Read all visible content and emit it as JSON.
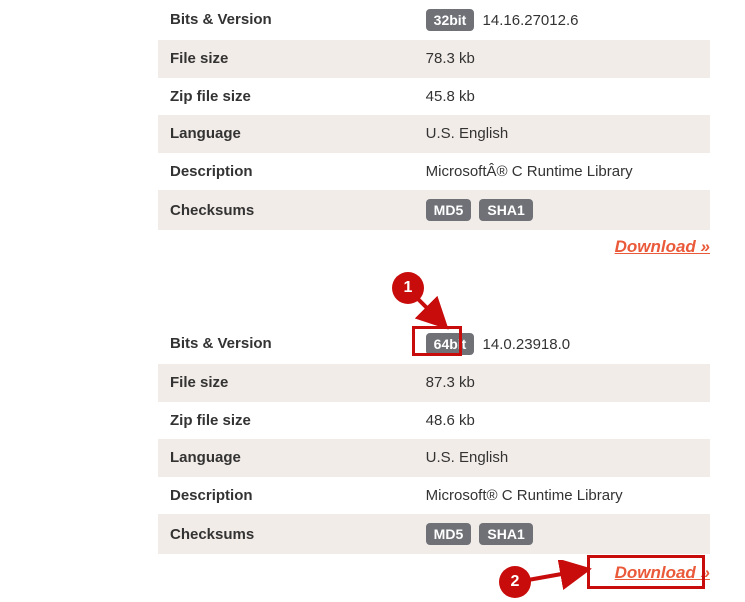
{
  "tables": [
    {
      "rows": [
        {
          "label": "Bits & Version",
          "badge": "32bit",
          "text": "14.16.27012.6"
        },
        {
          "label": "File size",
          "text": "78.3 kb"
        },
        {
          "label": "Zip file size",
          "text": "45.8 kb"
        },
        {
          "label": "Language",
          "text": "U.S. English"
        },
        {
          "label": "Description",
          "text": "MicrosoftÂ® C Runtime Library"
        },
        {
          "label": "Checksums",
          "badges": [
            "MD5",
            "SHA1"
          ]
        }
      ],
      "download": "Download »"
    },
    {
      "rows": [
        {
          "label": "Bits & Version",
          "badge": "64bit",
          "text": "14.0.23918.0"
        },
        {
          "label": "File size",
          "text": "87.3 kb"
        },
        {
          "label": "Zip file size",
          "text": "48.6 kb"
        },
        {
          "label": "Language",
          "text": "U.S. English"
        },
        {
          "label": "Description",
          "text": "Microsoft® C Runtime Library"
        },
        {
          "label": "Checksums",
          "badges": [
            "MD5",
            "SHA1"
          ]
        }
      ],
      "download": "Download »"
    }
  ],
  "annotations": {
    "a1": "1",
    "a2": "2"
  }
}
